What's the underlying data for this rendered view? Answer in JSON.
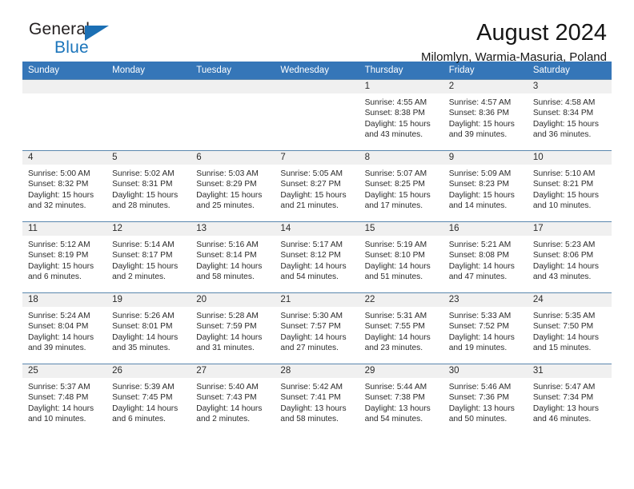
{
  "brand": {
    "name_part1": "General",
    "name_part2": "Blue",
    "triangle_color": "#1b6fb4",
    "blue_color": "#1b75bb"
  },
  "header": {
    "title": "August 2024",
    "subtitle": "Milomlyn, Warmia-Masuria, Poland"
  },
  "theme": {
    "header_row_bg": "#3576b8",
    "day_band_bg": "#f0f0f0",
    "grid_line": "#4a7ca8"
  },
  "weekdays": [
    "Sunday",
    "Monday",
    "Tuesday",
    "Wednesday",
    "Thursday",
    "Friday",
    "Saturday"
  ],
  "weeks": [
    [
      {
        "day": "",
        "empty": true
      },
      {
        "day": "",
        "empty": true
      },
      {
        "day": "",
        "empty": true
      },
      {
        "day": "",
        "empty": true
      },
      {
        "day": "1",
        "sunrise": "Sunrise: 4:55 AM",
        "sunset": "Sunset: 8:38 PM",
        "daylight1": "Daylight: 15 hours",
        "daylight2": "and 43 minutes."
      },
      {
        "day": "2",
        "sunrise": "Sunrise: 4:57 AM",
        "sunset": "Sunset: 8:36 PM",
        "daylight1": "Daylight: 15 hours",
        "daylight2": "and 39 minutes."
      },
      {
        "day": "3",
        "sunrise": "Sunrise: 4:58 AM",
        "sunset": "Sunset: 8:34 PM",
        "daylight1": "Daylight: 15 hours",
        "daylight2": "and 36 minutes."
      }
    ],
    [
      {
        "day": "4",
        "sunrise": "Sunrise: 5:00 AM",
        "sunset": "Sunset: 8:32 PM",
        "daylight1": "Daylight: 15 hours",
        "daylight2": "and 32 minutes."
      },
      {
        "day": "5",
        "sunrise": "Sunrise: 5:02 AM",
        "sunset": "Sunset: 8:31 PM",
        "daylight1": "Daylight: 15 hours",
        "daylight2": "and 28 minutes."
      },
      {
        "day": "6",
        "sunrise": "Sunrise: 5:03 AM",
        "sunset": "Sunset: 8:29 PM",
        "daylight1": "Daylight: 15 hours",
        "daylight2": "and 25 minutes."
      },
      {
        "day": "7",
        "sunrise": "Sunrise: 5:05 AM",
        "sunset": "Sunset: 8:27 PM",
        "daylight1": "Daylight: 15 hours",
        "daylight2": "and 21 minutes."
      },
      {
        "day": "8",
        "sunrise": "Sunrise: 5:07 AM",
        "sunset": "Sunset: 8:25 PM",
        "daylight1": "Daylight: 15 hours",
        "daylight2": "and 17 minutes."
      },
      {
        "day": "9",
        "sunrise": "Sunrise: 5:09 AM",
        "sunset": "Sunset: 8:23 PM",
        "daylight1": "Daylight: 15 hours",
        "daylight2": "and 14 minutes."
      },
      {
        "day": "10",
        "sunrise": "Sunrise: 5:10 AM",
        "sunset": "Sunset: 8:21 PM",
        "daylight1": "Daylight: 15 hours",
        "daylight2": "and 10 minutes."
      }
    ],
    [
      {
        "day": "11",
        "sunrise": "Sunrise: 5:12 AM",
        "sunset": "Sunset: 8:19 PM",
        "daylight1": "Daylight: 15 hours",
        "daylight2": "and 6 minutes."
      },
      {
        "day": "12",
        "sunrise": "Sunrise: 5:14 AM",
        "sunset": "Sunset: 8:17 PM",
        "daylight1": "Daylight: 15 hours",
        "daylight2": "and 2 minutes."
      },
      {
        "day": "13",
        "sunrise": "Sunrise: 5:16 AM",
        "sunset": "Sunset: 8:14 PM",
        "daylight1": "Daylight: 14 hours",
        "daylight2": "and 58 minutes."
      },
      {
        "day": "14",
        "sunrise": "Sunrise: 5:17 AM",
        "sunset": "Sunset: 8:12 PM",
        "daylight1": "Daylight: 14 hours",
        "daylight2": "and 54 minutes."
      },
      {
        "day": "15",
        "sunrise": "Sunrise: 5:19 AM",
        "sunset": "Sunset: 8:10 PM",
        "daylight1": "Daylight: 14 hours",
        "daylight2": "and 51 minutes."
      },
      {
        "day": "16",
        "sunrise": "Sunrise: 5:21 AM",
        "sunset": "Sunset: 8:08 PM",
        "daylight1": "Daylight: 14 hours",
        "daylight2": "and 47 minutes."
      },
      {
        "day": "17",
        "sunrise": "Sunrise: 5:23 AM",
        "sunset": "Sunset: 8:06 PM",
        "daylight1": "Daylight: 14 hours",
        "daylight2": "and 43 minutes."
      }
    ],
    [
      {
        "day": "18",
        "sunrise": "Sunrise: 5:24 AM",
        "sunset": "Sunset: 8:04 PM",
        "daylight1": "Daylight: 14 hours",
        "daylight2": "and 39 minutes."
      },
      {
        "day": "19",
        "sunrise": "Sunrise: 5:26 AM",
        "sunset": "Sunset: 8:01 PM",
        "daylight1": "Daylight: 14 hours",
        "daylight2": "and 35 minutes."
      },
      {
        "day": "20",
        "sunrise": "Sunrise: 5:28 AM",
        "sunset": "Sunset: 7:59 PM",
        "daylight1": "Daylight: 14 hours",
        "daylight2": "and 31 minutes."
      },
      {
        "day": "21",
        "sunrise": "Sunrise: 5:30 AM",
        "sunset": "Sunset: 7:57 PM",
        "daylight1": "Daylight: 14 hours",
        "daylight2": "and 27 minutes."
      },
      {
        "day": "22",
        "sunrise": "Sunrise: 5:31 AM",
        "sunset": "Sunset: 7:55 PM",
        "daylight1": "Daylight: 14 hours",
        "daylight2": "and 23 minutes."
      },
      {
        "day": "23",
        "sunrise": "Sunrise: 5:33 AM",
        "sunset": "Sunset: 7:52 PM",
        "daylight1": "Daylight: 14 hours",
        "daylight2": "and 19 minutes."
      },
      {
        "day": "24",
        "sunrise": "Sunrise: 5:35 AM",
        "sunset": "Sunset: 7:50 PM",
        "daylight1": "Daylight: 14 hours",
        "daylight2": "and 15 minutes."
      }
    ],
    [
      {
        "day": "25",
        "sunrise": "Sunrise: 5:37 AM",
        "sunset": "Sunset: 7:48 PM",
        "daylight1": "Daylight: 14 hours",
        "daylight2": "and 10 minutes."
      },
      {
        "day": "26",
        "sunrise": "Sunrise: 5:39 AM",
        "sunset": "Sunset: 7:45 PM",
        "daylight1": "Daylight: 14 hours",
        "daylight2": "and 6 minutes."
      },
      {
        "day": "27",
        "sunrise": "Sunrise: 5:40 AM",
        "sunset": "Sunset: 7:43 PM",
        "daylight1": "Daylight: 14 hours",
        "daylight2": "and 2 minutes."
      },
      {
        "day": "28",
        "sunrise": "Sunrise: 5:42 AM",
        "sunset": "Sunset: 7:41 PM",
        "daylight1": "Daylight: 13 hours",
        "daylight2": "and 58 minutes."
      },
      {
        "day": "29",
        "sunrise": "Sunrise: 5:44 AM",
        "sunset": "Sunset: 7:38 PM",
        "daylight1": "Daylight: 13 hours",
        "daylight2": "and 54 minutes."
      },
      {
        "day": "30",
        "sunrise": "Sunrise: 5:46 AM",
        "sunset": "Sunset: 7:36 PM",
        "daylight1": "Daylight: 13 hours",
        "daylight2": "and 50 minutes."
      },
      {
        "day": "31",
        "sunrise": "Sunrise: 5:47 AM",
        "sunset": "Sunset: 7:34 PM",
        "daylight1": "Daylight: 13 hours",
        "daylight2": "and 46 minutes."
      }
    ]
  ]
}
